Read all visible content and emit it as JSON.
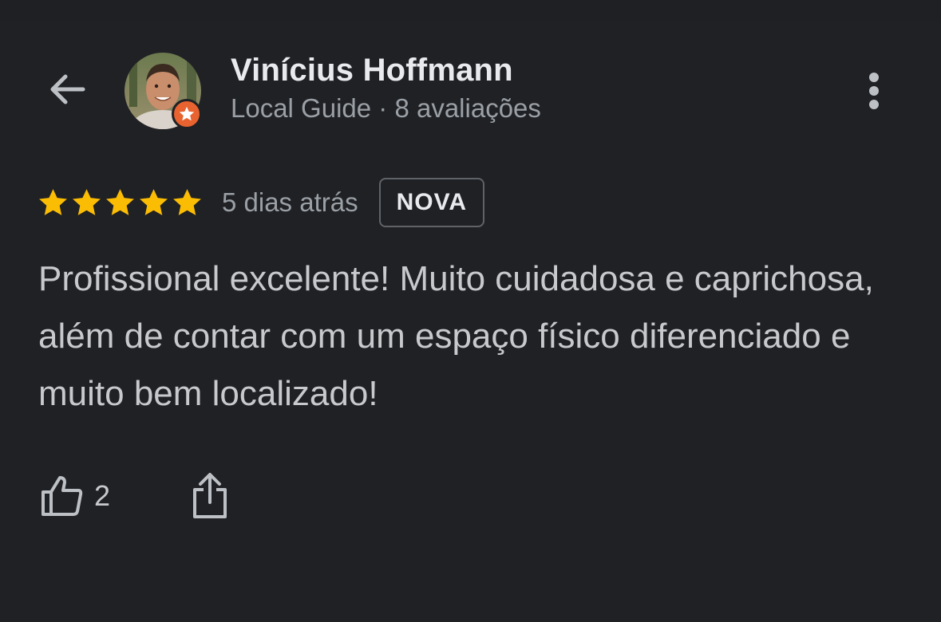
{
  "header": {
    "user_name": "Vinícius Hoffmann",
    "user_meta": "Local Guide · 8 avaliações",
    "icons": {
      "back": "arrow-left-icon",
      "more": "more-vertical-icon",
      "badge": "local-guide-star-icon"
    }
  },
  "review": {
    "rating": 5,
    "rating_max": 5,
    "date": "5 dias atrás",
    "badge": "NOVA",
    "text": "Profissional excelente! Muito cuidadosa e caprichosa, além de contar com um espaço físico diferenciado e muito bem localizado!",
    "likes": "2"
  },
  "colors": {
    "background": "#202124",
    "star": "#fbbc04",
    "guide_badge": "#e8632f",
    "text_primary": "#e8eaed",
    "text_secondary": "#9aa0a6"
  }
}
